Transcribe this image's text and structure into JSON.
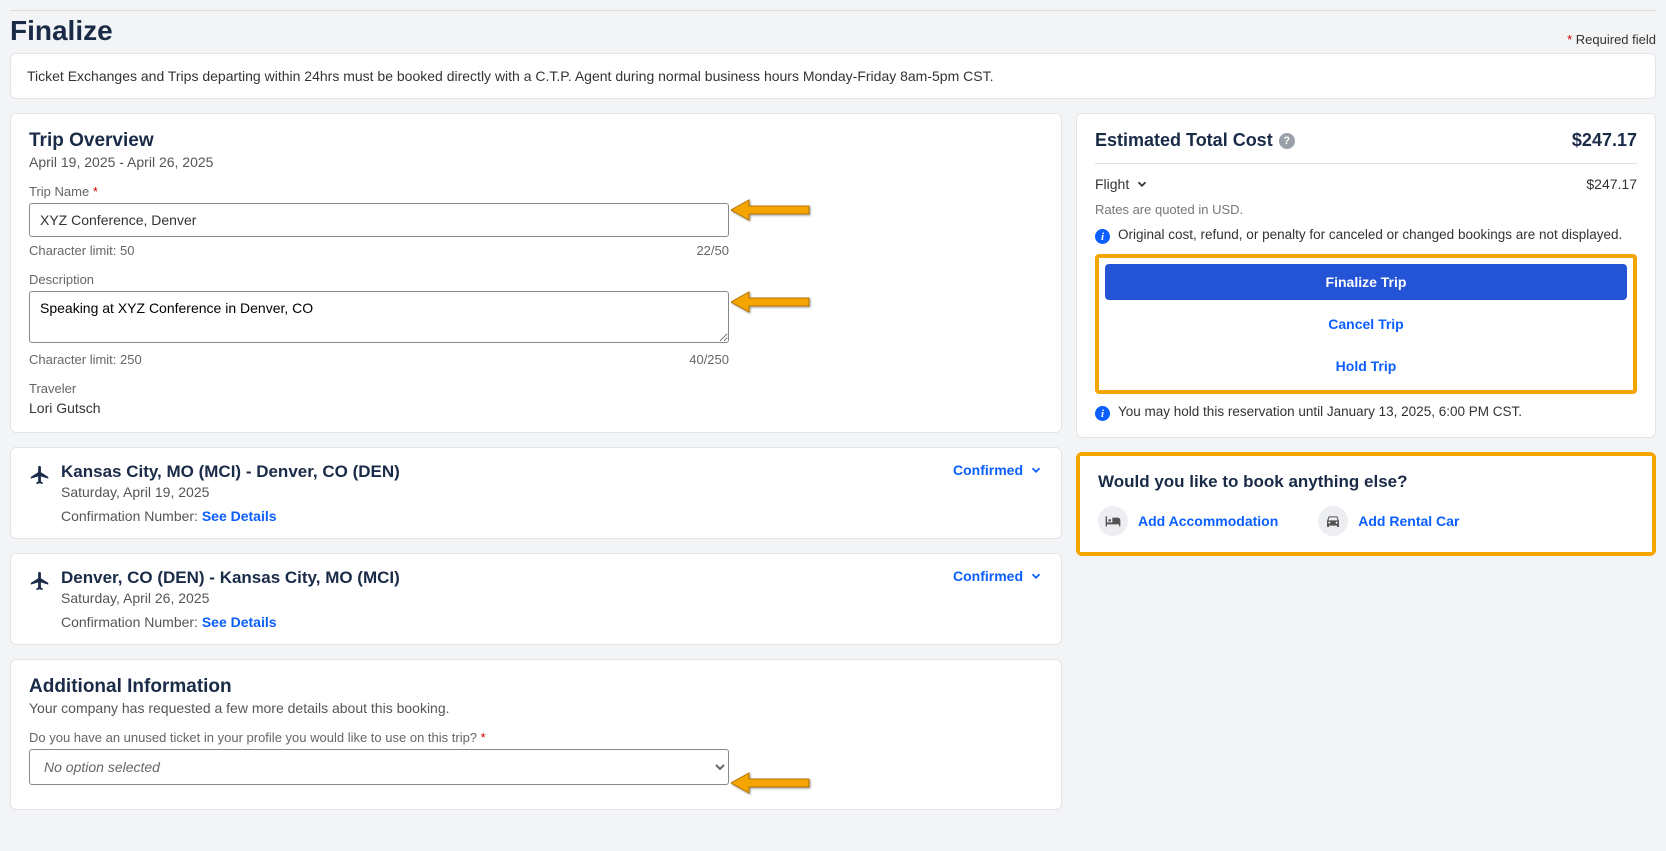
{
  "header": {
    "title": "Finalize",
    "required_hint": "Required field"
  },
  "notice": "Ticket Exchanges and Trips departing within 24hrs must be booked directly with a C.T.P. Agent during normal business hours Monday-Friday 8am-5pm CST.",
  "trip_overview": {
    "heading": "Trip Overview",
    "dates": "April 19, 2025 - April 26, 2025",
    "trip_name_label": "Trip Name",
    "trip_name_value": "XYZ Conference, Denver",
    "trip_name_char_limit_label": "Character limit: 50",
    "trip_name_char_count": "22/50",
    "description_label": "Description",
    "description_value": "Speaking at XYZ Conference in Denver, CO",
    "description_char_limit_label": "Character limit: 250",
    "description_char_count": "40/250",
    "traveler_label": "Traveler",
    "traveler_name": "Lori Gutsch"
  },
  "flights": [
    {
      "route": "Kansas City, MO (MCI) - Denver, CO (DEN)",
      "date": "Saturday, April 19, 2025",
      "confirmation_label": "Confirmation Number:",
      "see_details": "See Details",
      "status": "Confirmed"
    },
    {
      "route": "Denver, CO (DEN) - Kansas City, MO (MCI)",
      "date": "Saturday, April 26, 2025",
      "confirmation_label": "Confirmation Number:",
      "see_details": "See Details",
      "status": "Confirmed"
    }
  ],
  "additional": {
    "heading": "Additional Information",
    "subtext": "Your company has requested a few more details about this booking.",
    "question": "Do you have an unused ticket in your profile you would like to use on this trip?",
    "placeholder": "No option selected"
  },
  "cost": {
    "title": "Estimated Total Cost",
    "total": "$247.17",
    "line_label": "Flight",
    "line_amount": "$247.17",
    "currency_note": "Rates are quoted in USD.",
    "penalty_note": "Original cost, refund, or penalty for canceled or changed bookings are not displayed.",
    "finalize_btn": "Finalize Trip",
    "cancel_btn": "Cancel Trip",
    "hold_btn": "Hold Trip",
    "hold_note": "You may hold this reservation until January 13, 2025, 6:00 PM CST."
  },
  "book_more": {
    "heading": "Would you like to book anything else?",
    "accommodation": "Add Accommodation",
    "rental": "Add Rental Car"
  }
}
